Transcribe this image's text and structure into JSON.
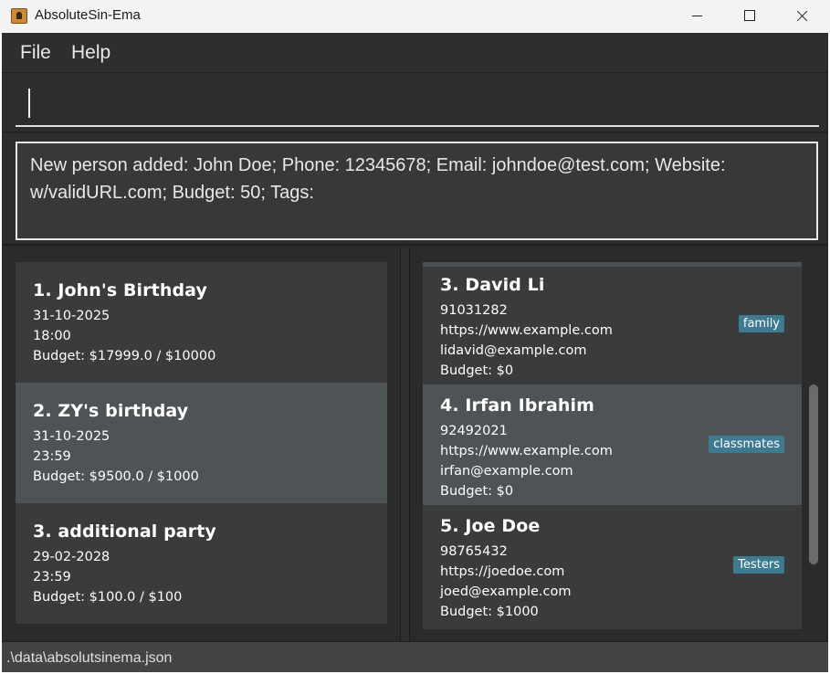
{
  "window": {
    "title": "AbsoluteSin-Ema"
  },
  "menu": {
    "file": "File",
    "help": "Help"
  },
  "command": {
    "value": "",
    "placeholder": ""
  },
  "result": {
    "message": "New person added: John Doe; Phone: 12345678; Email: johndoe@test.com; Website: w/validURL.com; Budget: 50; Tags:"
  },
  "events": [
    {
      "title": "1. John's Birthday",
      "date": "31-10-2025",
      "time": "18:00",
      "budget": "Budget: $17999.0 / $10000"
    },
    {
      "title": "2. ZY's birthday",
      "date": "31-10-2025",
      "time": "23:59",
      "budget": "Budget: $9500.0 / $1000"
    },
    {
      "title": "3. additional party",
      "date": "29-02-2028",
      "time": "23:59",
      "budget": "Budget: $100.0 / $100"
    }
  ],
  "persons": [
    {
      "name": "3. David Li",
      "phone": "91031282",
      "website": "https://www.example.com",
      "email": "lidavid@example.com",
      "budget": "Budget: $0",
      "tag": "family"
    },
    {
      "name": "4. Irfan Ibrahim",
      "phone": "92492021",
      "website": "https://www.example.com",
      "email": "irfan@example.com",
      "budget": "Budget: $0",
      "tag": "classmates"
    },
    {
      "name": "5. Joe Doe",
      "phone": "98765432",
      "website": "https://joedoe.com",
      "email": "joed@example.com",
      "budget": "Budget: $1000",
      "tag": "Testers"
    }
  ],
  "status": {
    "path": ".\\data\\absolutsinema.json"
  },
  "colors": {
    "background": "#2a2a2a",
    "card": "#3a3b3d",
    "selected": "#4e5356",
    "tag": "#3e7b91"
  }
}
